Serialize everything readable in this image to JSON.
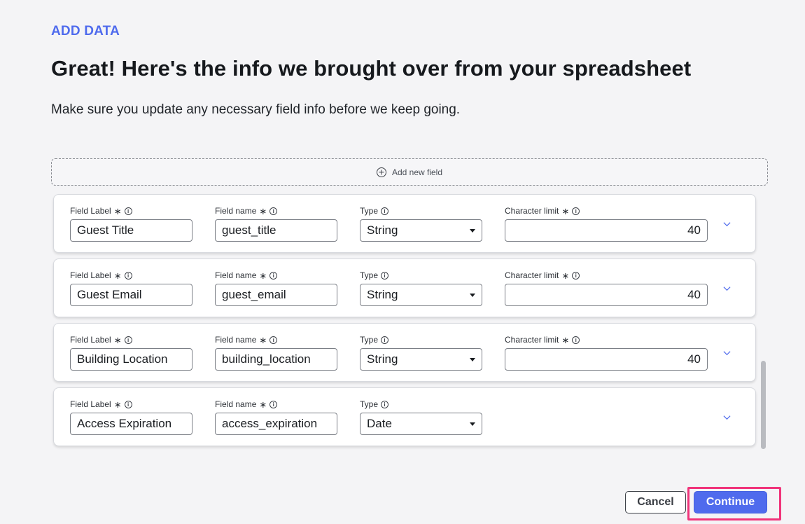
{
  "header": {
    "eyebrow": "ADD DATA",
    "title": "Great! Here's the info we brought over from your spreadsheet",
    "subtitle": "Make sure you update any necessary field info before we keep going."
  },
  "add_field": {
    "label": "Add new field",
    "icon": "plus-circle-icon"
  },
  "labels": {
    "field_label": "Field Label",
    "field_name": "Field name",
    "type": "Type",
    "char_limit": "Character limit",
    "required_mark": "∗",
    "info_glyph": "i"
  },
  "fields": [
    {
      "label": "Guest Title",
      "name": "guest_title",
      "type": "String",
      "limit": "40"
    },
    {
      "label": "Guest Email",
      "name": "guest_email",
      "type": "String",
      "limit": "40"
    },
    {
      "label": "Building Location",
      "name": "building_location",
      "type": "String",
      "limit": "40"
    },
    {
      "label": "Access Expiration",
      "name": "access_expiration",
      "type": "Date"
    }
  ],
  "footer": {
    "cancel": "Cancel",
    "continue": "Continue"
  },
  "colors": {
    "accent": "#4f6bed",
    "focus": "#f0347a",
    "background": "#f4f4f6"
  }
}
